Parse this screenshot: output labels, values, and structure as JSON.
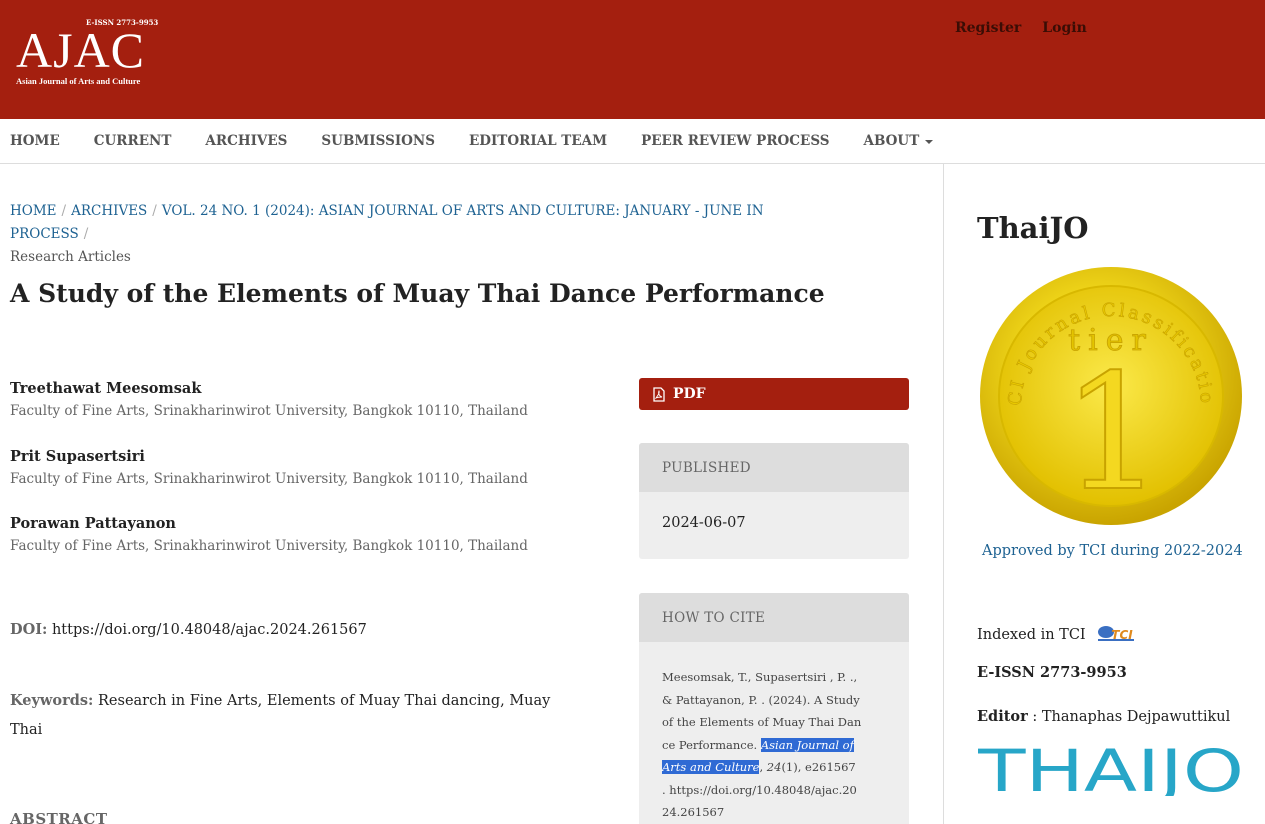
{
  "header": {
    "logo_text": "AJAC",
    "logo_issn": "E-ISSN 2773-9953",
    "logo_subtitle": "Asian Journal of Arts and Culture",
    "register_label": "Register",
    "login_label": "Login"
  },
  "nav": {
    "items": [
      "HOME",
      "CURRENT",
      "ARCHIVES",
      "SUBMISSIONS",
      "EDITORIAL TEAM",
      "PEER REVIEW PROCESS",
      "ABOUT"
    ]
  },
  "breadcrumb": {
    "home": "HOME",
    "archives": "ARCHIVES",
    "issue": "VOL. 24 NO. 1 (2024): ASIAN JOURNAL OF ARTS AND CULTURE: JANUARY - JUNE IN PROCESS",
    "current": "Research Articles"
  },
  "article": {
    "title": "A Study of the Elements of Muay Thai Dance Performance",
    "authors": [
      {
        "name": "Treethawat Meesomsak",
        "affiliation": "Faculty of Fine Arts, Srinakharinwirot University, Bangkok 10110, Thailand"
      },
      {
        "name": "Prit Supasertsiri",
        "affiliation": "Faculty of Fine Arts, Srinakharinwirot University, Bangkok 10110, Thailand"
      },
      {
        "name": "Porawan Pattayanon",
        "affiliation": "Faculty of Fine Arts, Srinakharinwirot University, Bangkok 10110, Thailand"
      }
    ],
    "doi_label": "DOI:",
    "doi_value": "https://doi.org/10.48048/ajac.2024.261567",
    "keywords_label": "Keywords:",
    "keywords_value": "Research in Fine Arts, Elements of Muay Thai dancing, Muay Thai",
    "abstract_heading": "ABSTRACT"
  },
  "details": {
    "pdf_label": "PDF",
    "published_heading": "PUBLISHED",
    "published_date": "2024-06-07",
    "cite_heading": "HOW TO CITE",
    "cite_before": "Meesomsak, T., Supasertsiri , P. ., & Pattayanon, P. . (2024). A Study of the Elements of Muay Thai Dance Performance. ",
    "cite_journal": "Asian Journal of Arts and Culture",
    "cite_comma": ", ",
    "cite_volume": "24",
    "cite_after": "(1), e261567 . https://doi.org/10.48048/ajac.2024.261567"
  },
  "sidebar": {
    "title": "ThaiJO",
    "medal_text": "TCI Journal Classification",
    "medal_tier": "tier",
    "medal_number": "1",
    "approved_text": "Approved by TCI during 2022-2024",
    "indexed_text": "Indexed in TCI",
    "tci_logo_text": "TCI",
    "eissn": "E-ISSN 2773-9953",
    "editor_label": "Editor",
    "editor_sep": " : ",
    "editor_name": "Thanaphas Dejpawuttikul",
    "thaijo_logo_text": "THAIJO"
  },
  "colors": {
    "brand": "#a41f0f",
    "link": "#1e6292",
    "highlight": "#2f6ad4",
    "thaijo_blue": "#27a6c8",
    "medal_gold": "#f0d010"
  }
}
